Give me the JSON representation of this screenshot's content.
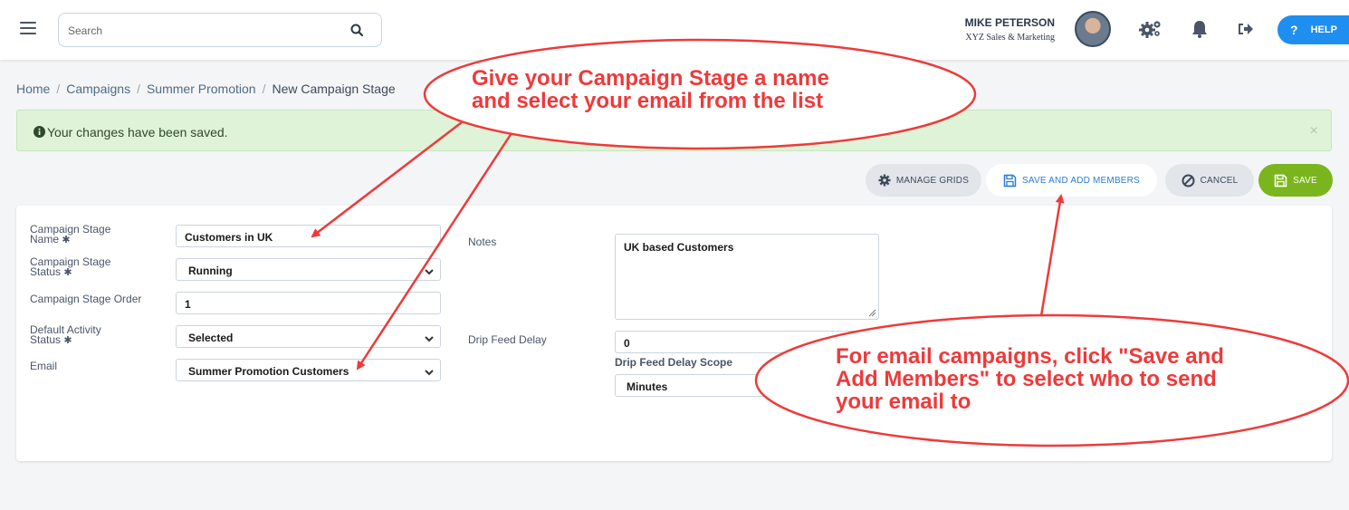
{
  "search": {
    "placeholder": "Search"
  },
  "user": {
    "name": "MIKE PETERSON",
    "company": "XYZ Sales & Marketing"
  },
  "header": {
    "help_label": "HELP"
  },
  "breadcrumb": {
    "items": [
      "Home",
      "Campaigns",
      "Summer Promotion"
    ],
    "current": "New Campaign Stage"
  },
  "alert": {
    "message": "Your changes have been saved."
  },
  "actions": {
    "manage_grids": "MANAGE GRIDS",
    "save_and_add_members": "SAVE AND ADD MEMBERS",
    "cancel": "CANCEL",
    "save": "SAVE"
  },
  "form": {
    "stage_name_label_line1": "Campaign Stage",
    "stage_name_label_line2": "Name",
    "stage_name_value": "Customers in UK",
    "stage_status_label_line1": "Campaign Stage",
    "stage_status_label_line2": "Status",
    "stage_status_value": "Running",
    "stage_order_label": "Campaign Stage Order",
    "stage_order_value": "1",
    "default_activity_label_line1": "Default Activity",
    "default_activity_label_line2": "Status",
    "default_activity_value": "Selected",
    "email_label": "Email",
    "email_value": "Summer Promotion Customers",
    "notes_label": "Notes",
    "notes_value": "UK based Customers",
    "drip_delay_label": "Drip Feed Delay",
    "drip_delay_value": "0",
    "drip_scope_label": "Drip Feed Delay Scope",
    "drip_scope_value": "Minutes",
    "required_marker": "✱"
  },
  "callouts": {
    "top_line1": "Give your Campaign Stage a name",
    "top_line2": "and select your email from the list",
    "bottom_line1": "For email campaigns, click \"Save and",
    "bottom_line2": "Add Members\" to select who to send",
    "bottom_line3": "your email to"
  },
  "colors": {
    "accent_blue": "#1e8ff0",
    "save_green": "#7ab51d",
    "alert_bg": "#dff3d8",
    "callout_red": "#ee3a3a"
  }
}
